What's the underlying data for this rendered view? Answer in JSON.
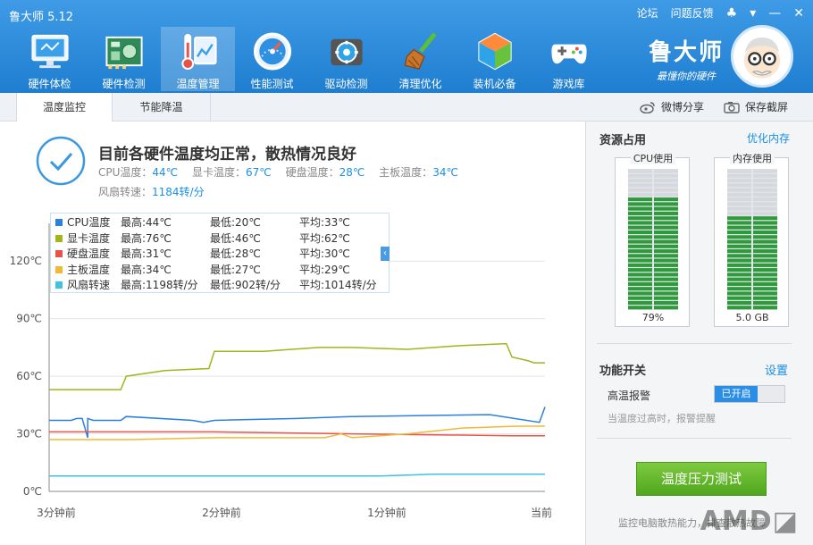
{
  "app": {
    "title": "鲁大师 5.12"
  },
  "window_controls": {
    "forum": "论坛",
    "feedback": "问题反馈"
  },
  "toolbar": [
    {
      "id": "hw-check",
      "label": "硬件体检",
      "icon": "monitor-icon"
    },
    {
      "id": "hw-detect",
      "label": "硬件检测",
      "icon": "circuit-board-icon"
    },
    {
      "id": "temp-manage",
      "label": "温度管理",
      "icon": "thermometer-icon",
      "active": true
    },
    {
      "id": "perf-test",
      "label": "性能测试",
      "icon": "gauge-icon"
    },
    {
      "id": "driver-check",
      "label": "驱动检测",
      "icon": "gear-icon"
    },
    {
      "id": "clean-optimize",
      "label": "清理优化",
      "icon": "broom-icon"
    },
    {
      "id": "install-essentials",
      "label": "装机必备",
      "icon": "cube-icon"
    },
    {
      "id": "game-library",
      "label": "游戏库",
      "icon": "gamepad-icon"
    }
  ],
  "brand": {
    "name": "鲁大师",
    "slogan": "最懂你的硬件"
  },
  "subtabs": {
    "monitor": "温度监控",
    "energy": "节能降温",
    "share": "微博分享",
    "screenshot": "保存截屏"
  },
  "status": {
    "title": "目前各硬件温度均正常，散热情况良好",
    "cpu_label": "CPU温度：",
    "cpu_value": "44℃",
    "gpu_label": "显卡温度：",
    "gpu_value": "67℃",
    "disk_label": "硬盘温度：",
    "disk_value": "28℃",
    "board_label": "主板温度：",
    "board_value": "34℃",
    "fan_label": "风扇转速：",
    "fan_value": "1184转/分"
  },
  "legend": [
    {
      "name": "CPU温度",
      "max": "最高:44℃",
      "min": "最低:20℃",
      "avg": "平均:33℃",
      "color": "#2b7fe0"
    },
    {
      "name": "显卡温度",
      "max": "最高:76℃",
      "min": "最低:46℃",
      "avg": "平均:62℃",
      "color": "#a3b51a"
    },
    {
      "name": "硬盘温度",
      "max": "最高:31℃",
      "min": "最低:28℃",
      "avg": "平均:30℃",
      "color": "#e5534b"
    },
    {
      "name": "主板温度",
      "max": "最高:34℃",
      "min": "最低:27℃",
      "avg": "平均:29℃",
      "color": "#f0b93a"
    },
    {
      "name": "风扇转速",
      "max": "最高:1198转/分",
      "min": "最低:902转/分",
      "avg": "平均:1014转/分",
      "color": "#3ec3e0"
    }
  ],
  "chart_data": {
    "type": "line",
    "x_labels": [
      "3分钟前",
      "2分钟前",
      "1分钟前",
      "当前"
    ],
    "y_ticks": [
      "0℃",
      "30℃",
      "60℃",
      "90℃",
      "120℃"
    ],
    "ylim": [
      0,
      135
    ],
    "xlim": [
      0,
      180
    ],
    "series": [
      {
        "name": "CPU温度",
        "color": "#2b7fe0",
        "x": [
          0,
          8,
          10,
          12,
          14,
          14,
          16,
          26,
          28,
          52,
          56,
          60,
          90,
          110,
          160,
          178,
          180
        ],
        "y": [
          37,
          37,
          38,
          38,
          28,
          38,
          37,
          37,
          39,
          37,
          36,
          37,
          38,
          39,
          40,
          36,
          44
        ]
      },
      {
        "name": "显卡温度",
        "color": "#a3b51a",
        "x": [
          0,
          8,
          26,
          28,
          42,
          58,
          60,
          78,
          88,
          98,
          110,
          130,
          150,
          166,
          168,
          174,
          176,
          180
        ],
        "y": [
          53,
          53,
          53,
          60,
          63,
          64,
          73,
          73,
          74,
          75,
          75,
          74,
          76,
          77,
          70,
          68,
          67,
          67
        ]
      },
      {
        "name": "硬盘温度",
        "color": "#e5534b",
        "x": [
          0,
          60,
          110,
          168,
          180
        ],
        "y": [
          31,
          31,
          30,
          29,
          29
        ]
      },
      {
        "name": "主板温度",
        "color": "#f0b93a",
        "x": [
          0,
          30,
          60,
          100,
          106,
          110,
          130,
          150,
          170,
          180
        ],
        "y": [
          27,
          27,
          28,
          28,
          30,
          28,
          30,
          33,
          34,
          34
        ]
      },
      {
        "name": "风扇转速",
        "color": "#3ec3e0",
        "x": [
          0,
          60,
          120,
          140,
          170,
          180
        ],
        "y": [
          8,
          8,
          8,
          9,
          9,
          9
        ]
      }
    ]
  },
  "resources": {
    "title": "资源占用",
    "optimize": "优化内存",
    "cpu_label": "CPU使用",
    "cpu_value": "79%",
    "cpu_fill": 0.79,
    "mem_label": "内存使用",
    "mem_value": "5.0 GB",
    "mem_fill": 0.66
  },
  "functions": {
    "title": "功能开关",
    "settings": "设置",
    "alarm_label": "高温报警",
    "alarm_state": "已开启",
    "alarm_desc": "当温度过高时，报警提醒"
  },
  "stress": {
    "button": "温度压力测试",
    "desc": "监控电脑散热能力，排查散热故障"
  }
}
